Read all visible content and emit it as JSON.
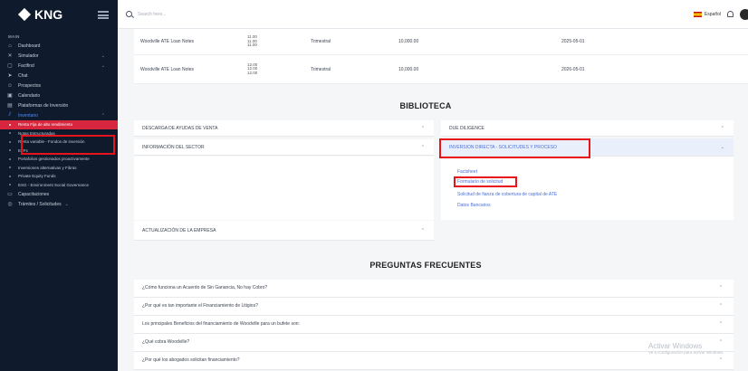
{
  "brand": {
    "name": "KNG"
  },
  "search": {
    "placeholder": "Search here..."
  },
  "topbar": {
    "language": "Español"
  },
  "sidebar": {
    "section_label": "MAIN",
    "items": [
      {
        "label": "Dashboard",
        "icon": "home-icon",
        "glyph": "⌂"
      },
      {
        "label": "Simulador",
        "icon": "calculator-icon",
        "glyph": "✕",
        "chevron": "⌄"
      },
      {
        "label": "Factfind",
        "icon": "clipboard-icon",
        "glyph": "▢",
        "chevron": "⌄"
      },
      {
        "label": "Chat",
        "icon": "send-icon",
        "glyph": "➤"
      },
      {
        "label": "Prospectos",
        "icon": "users-icon",
        "glyph": "☺"
      },
      {
        "label": "Calendario",
        "icon": "calendar-icon",
        "glyph": "▣"
      },
      {
        "label": "Plataformas de Inversión",
        "icon": "platform-icon",
        "glyph": "▤"
      },
      {
        "label": "Inventario",
        "icon": "chart-icon",
        "glyph": "⫽",
        "chevron": "⌃"
      }
    ],
    "sub_items": [
      "Renta Fija de alto rendimiento",
      "Notas Estructuradas",
      "Renta variable - Fondos de inversión",
      "ETFs",
      "Portafolios gestionados proactivamente",
      "Inversiones alternativas y Fibras",
      "Private Equity Funds",
      "ESG - Environment Social Governance"
    ],
    "items_after": [
      {
        "label": "Capacitaciones",
        "icon": "training-icon",
        "glyph": "▭"
      },
      {
        "label": "Trámites / Solicitudes",
        "icon": "forms-icon",
        "glyph": "◎",
        "chevron": "⌄"
      }
    ]
  },
  "loans": [
    {
      "name": "Woodville ATE Loan Notes",
      "rates": [
        "11.00",
        "11.00",
        "11.00"
      ],
      "frequency": "Trimestral",
      "amount": "10,000.00",
      "date": "2025-05-01"
    },
    {
      "name": "Woodville ATE Loan Notes",
      "rates": [
        "12.00",
        "12.00",
        "12.00"
      ],
      "frequency": "Trimestral",
      "amount": "10,000.00",
      "date": "2026-05-01"
    }
  ],
  "biblioteca": {
    "title": "BIBLIOTECA",
    "left": [
      "DESCARGA DE AYUDAS DE VENTA",
      "INFORMACIÓN DEL SECTOR",
      "ACTUALIZACIÓN DE LA EMPRESA"
    ],
    "right": [
      "DUE DILIGENCE",
      "INVERSION DIRECTA - SOLICITUDES Y PROCESO"
    ],
    "open_links": [
      "Factsheet",
      "Formulario de solicitud",
      "Solicitud de fianza de cobertura de capital de ATE",
      "Datos Bancarios"
    ]
  },
  "faq": {
    "title": "PREGUNTAS FRECUENTES",
    "items": [
      "¿Cómo funciona un Acuerdo de Sin Ganancia, No hay Cobro?",
      "¿Por qué es tan importante el Financiamiento de Litigios?",
      "Los principales Beneficios del financiamiento de Woodville para un bufete son:",
      "¿Qué cobra Woodville?",
      "¿Por qué los abogados solicitan financiamiento?"
    ]
  },
  "watermark": {
    "line1": "Activar Windows",
    "line2": "Ve a Configuración para activar Windows."
  },
  "colors": {
    "sidebar_bg": "#0f1b2d",
    "accent": "#4a6fd8",
    "highlight_red": "#e8141c",
    "selected_bg": "#d7263d"
  }
}
